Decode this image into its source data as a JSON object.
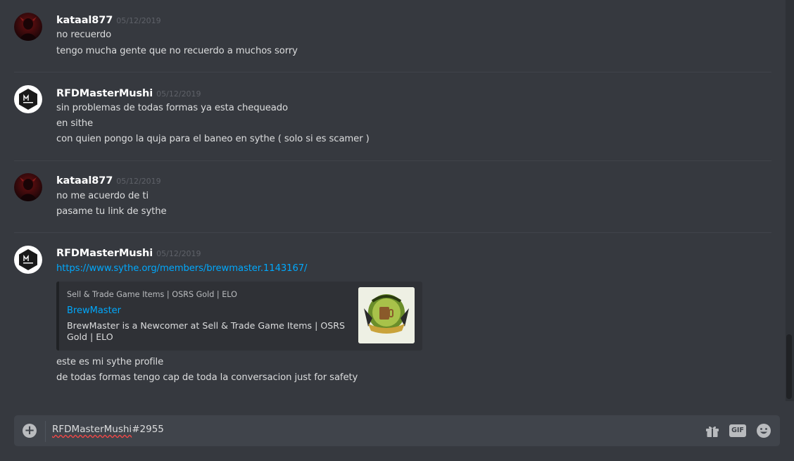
{
  "messages": [
    {
      "author": "kataal877",
      "timestamp": "05/12/2019",
      "avatar": "kataal-avatar",
      "lines": [
        "no recuerdo",
        "tengo mucha gente que no recuerdo a muchos sorry"
      ]
    },
    {
      "author": "RFDMasterMushi",
      "timestamp": "05/12/2019",
      "avatar": "rfd-avatar",
      "lines": [
        "sin problemas de todas formas ya esta chequeado",
        "en sithe",
        "con quien pongo la quja para el baneo en sythe  ( solo si es scamer )"
      ]
    },
    {
      "author": "kataal877",
      "timestamp": "05/12/2019",
      "avatar": "kataal-avatar",
      "lines": [
        "no me acuerdo de ti",
        "pasame tu link de sythe"
      ]
    },
    {
      "author": "RFDMasterMushi",
      "timestamp": "05/12/2019",
      "avatar": "rfd-avatar",
      "link": "https://www.sythe.org/members/brewmaster.1143167/",
      "embed": {
        "provider": "Sell & Trade Game Items | OSRS Gold | ELO",
        "title": "BrewMaster",
        "description": "BrewMaster is a Newcomer at Sell & Trade Game Items | OSRS Gold | ELO",
        "thumbnail_text": "BrewMaster"
      },
      "lines": [
        "este es mi sythe profile",
        "de todas formas tengo cap de toda la conversacion just for safety"
      ]
    }
  ],
  "composer": {
    "value": "RFDMasterMushi#2955",
    "misspelled_part": "RFDMasterMushi",
    "rest": "#2955",
    "attach_icon": "plus-circle-icon",
    "gift_icon": "gift-icon",
    "gif_label": "GIF",
    "emoji_icon": "emoji-smile-icon"
  },
  "colors": {
    "background": "#36393f",
    "link": "#00a8fc",
    "username": "#ffffff",
    "timestamp": "#5e6168"
  }
}
